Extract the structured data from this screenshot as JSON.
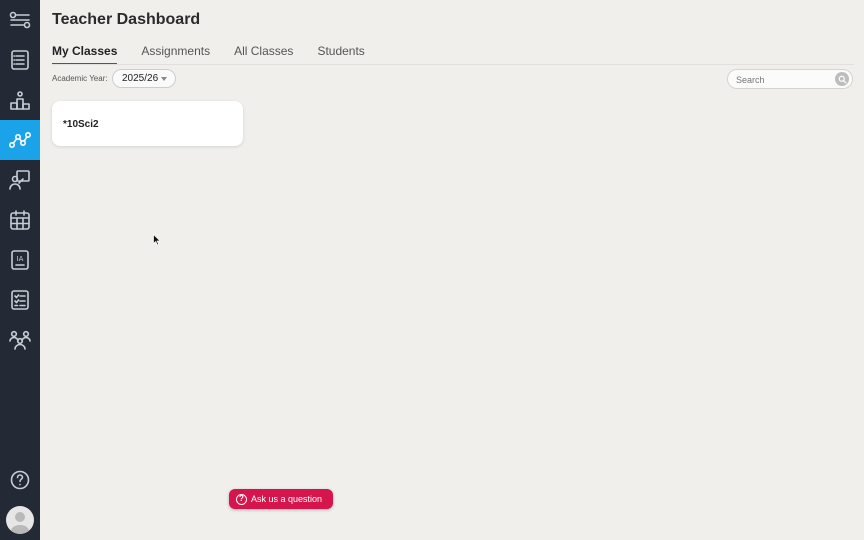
{
  "header": {
    "title": "Teacher Dashboard"
  },
  "tabs": [
    {
      "label": "My Classes",
      "active": true
    },
    {
      "label": "Assignments",
      "active": false
    },
    {
      "label": "All Classes",
      "active": false
    },
    {
      "label": "Students",
      "active": false
    }
  ],
  "filters": {
    "year_label": "Academic Year:",
    "year_value": "2025/26"
  },
  "search": {
    "placeholder": "Search",
    "value": ""
  },
  "classes": [
    {
      "name": "*10Sci2"
    }
  ],
  "help": {
    "ask_label": "Ask us a question",
    "ask_icon": "?"
  },
  "sidebar": {
    "items": [
      {
        "icon": "sliders-icon",
        "active": false
      },
      {
        "icon": "list-icon",
        "active": false
      },
      {
        "icon": "podium-icon",
        "active": false
      },
      {
        "icon": "network-icon",
        "active": true
      },
      {
        "icon": "presenter-icon",
        "active": false
      },
      {
        "icon": "calendar-icon",
        "active": false
      },
      {
        "icon": "ia-icon",
        "active": false
      },
      {
        "icon": "checklist-icon",
        "active": false
      },
      {
        "icon": "group-icon",
        "active": false
      },
      {
        "icon": "help-icon",
        "active": false
      }
    ],
    "ia_text": "IA"
  },
  "colors": {
    "sidebar_bg": "#232a36",
    "active_blue": "#1aa3e8",
    "accent_red": "#d6154d",
    "page_bg": "#f0efec"
  }
}
